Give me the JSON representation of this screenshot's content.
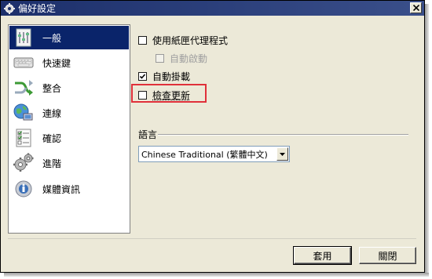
{
  "window": {
    "title": "偏好設定",
    "close_label": "×"
  },
  "sidebar": {
    "items": [
      {
        "label": "一般",
        "icon": "general-settings-icon",
        "selected": true
      },
      {
        "label": "快速鍵",
        "icon": "keyboard-icon",
        "selected": false
      },
      {
        "label": "整合",
        "icon": "integration-icon",
        "selected": false
      },
      {
        "label": "連線",
        "icon": "network-icon",
        "selected": false
      },
      {
        "label": "確認",
        "icon": "checklist-icon",
        "selected": false
      },
      {
        "label": "進階",
        "icon": "gears-icon",
        "selected": false
      },
      {
        "label": "媒體資訊",
        "icon": "media-info-icon",
        "selected": false
      }
    ]
  },
  "general": {
    "use_tray": {
      "label": "使用紙匣代理程式",
      "checked": false
    },
    "auto_start": {
      "label": "自動啟動",
      "checked": false,
      "disabled": true
    },
    "auto_mount": {
      "label": "自動掛載",
      "checked": true
    },
    "check_updates": {
      "label": "檢查更新",
      "checked": false
    },
    "language_group": {
      "label": "語言"
    },
    "language_select": {
      "value": "Chinese Traditional (繁體中文)"
    }
  },
  "buttons": {
    "apply": "套用",
    "close": "關閉"
  },
  "colors": {
    "selection": "#0a246a",
    "highlight_border": "#e0303a",
    "dialog_bg": "#ece9d8"
  }
}
